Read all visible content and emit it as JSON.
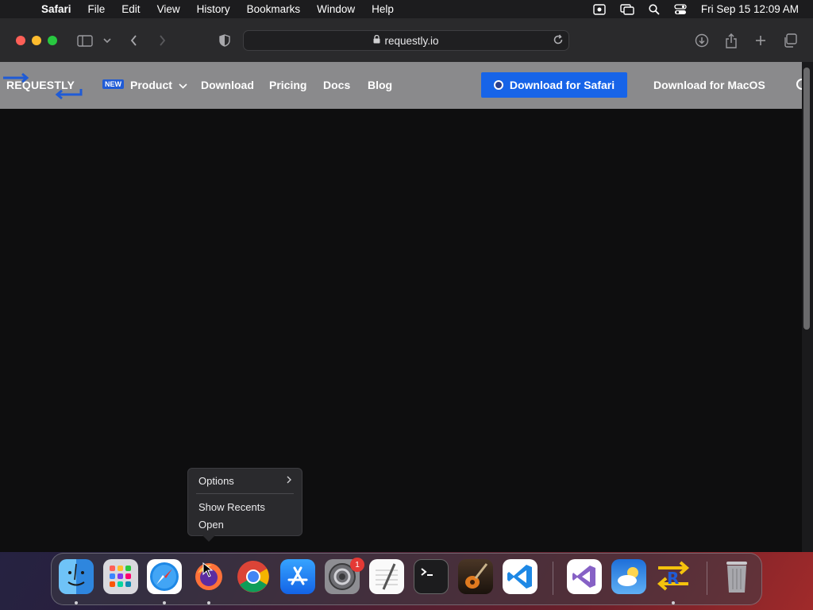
{
  "menubar": {
    "app_name": "Safari",
    "items": [
      "File",
      "Edit",
      "View",
      "History",
      "Bookmarks",
      "Window",
      "Help"
    ],
    "datetime": "Fri Sep 15  12:09 AM"
  },
  "browser": {
    "url": "requestly.io"
  },
  "site": {
    "logo_text": "REQUESTLY",
    "new_badge": "NEW",
    "nav": [
      "Product",
      "Download",
      "Pricing",
      "Docs",
      "Blog"
    ],
    "cta_primary": "Download for Safari",
    "cta_secondary": "Download for MacOS",
    "brand_color": "#1764e8"
  },
  "context_menu": {
    "items": [
      "Options",
      "Show Recents",
      "Open"
    ]
  },
  "dock": {
    "apps": [
      "Finder",
      "Launchpad",
      "Safari",
      "Firefox",
      "Google Chrome",
      "App Store",
      "System Settings",
      "TextEdit",
      "Terminal",
      "GarageBand",
      "Visual Studio Code",
      "Visual Studio",
      "Weather",
      "Requestly",
      "Trash"
    ],
    "settings_badge": "1"
  }
}
